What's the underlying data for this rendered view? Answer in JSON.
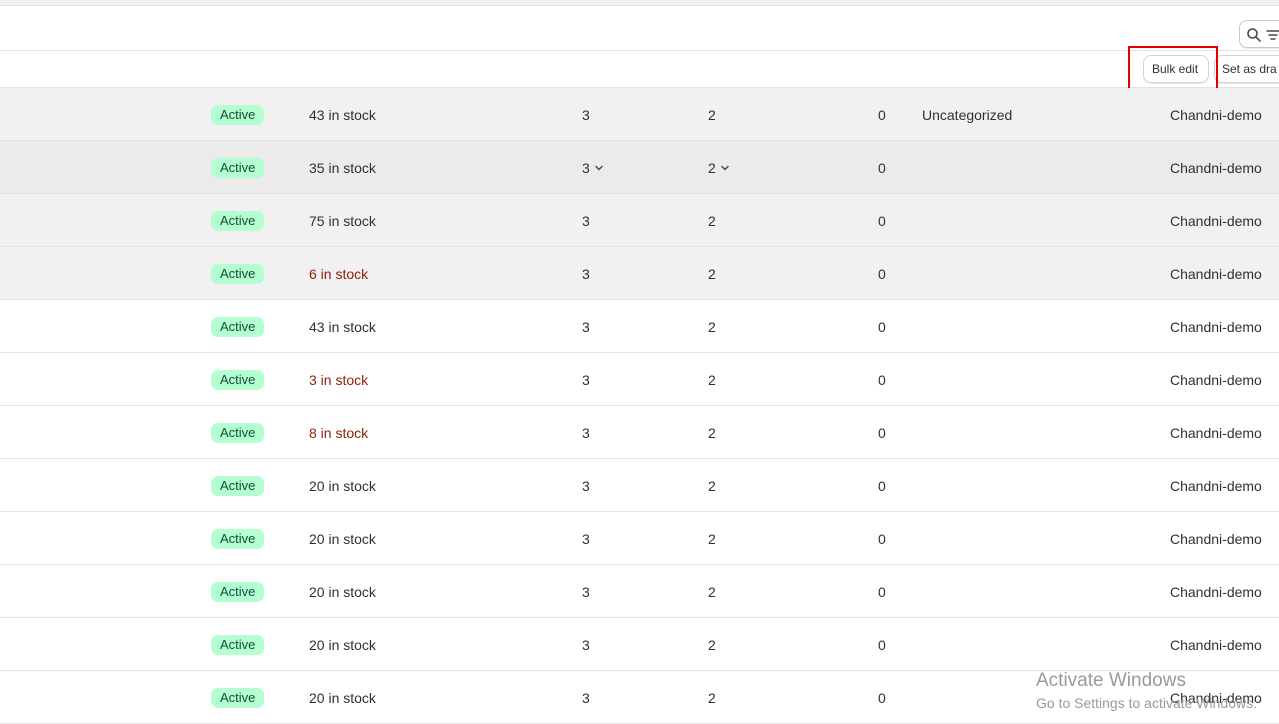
{
  "toolbar": {
    "search_filter_icons": [
      "search-icon",
      "filter-icon"
    ],
    "bulk_edit_label": "Bulk edit",
    "set_as_draft_label": "Set as dra"
  },
  "rows": [
    {
      "status": "Active",
      "inventory": "43 in stock",
      "low_stock": false,
      "markets": "3",
      "catalogs": "2",
      "sales_channels": "0",
      "category": "Uncategorized",
      "vendor": "Chandni-demo"
    },
    {
      "status": "Active",
      "inventory": "35 in stock",
      "low_stock": false,
      "markets": "3",
      "catalogs": "2",
      "sales_channels": "0",
      "category": "",
      "vendor": "Chandni-demo"
    },
    {
      "status": "Active",
      "inventory": "75 in stock",
      "low_stock": false,
      "markets": "3",
      "catalogs": "2",
      "sales_channels": "0",
      "category": "",
      "vendor": "Chandni-demo"
    },
    {
      "status": "Active",
      "inventory": "6 in stock",
      "low_stock": true,
      "markets": "3",
      "catalogs": "2",
      "sales_channels": "0",
      "category": "",
      "vendor": "Chandni-demo"
    },
    {
      "status": "Active",
      "inventory": "43 in stock",
      "low_stock": false,
      "markets": "3",
      "catalogs": "2",
      "sales_channels": "0",
      "category": "",
      "vendor": "Chandni-demo"
    },
    {
      "status": "Active",
      "inventory": "3 in stock",
      "low_stock": true,
      "markets": "3",
      "catalogs": "2",
      "sales_channels": "0",
      "category": "",
      "vendor": "Chandni-demo"
    },
    {
      "status": "Active",
      "inventory": "8 in stock",
      "low_stock": true,
      "markets": "3",
      "catalogs": "2",
      "sales_channels": "0",
      "category": "",
      "vendor": "Chandni-demo"
    },
    {
      "status": "Active",
      "inventory": "20 in stock",
      "low_stock": false,
      "markets": "3",
      "catalogs": "2",
      "sales_channels": "0",
      "category": "",
      "vendor": "Chandni-demo"
    },
    {
      "status": "Active",
      "inventory": "20 in stock",
      "low_stock": false,
      "markets": "3",
      "catalogs": "2",
      "sales_channels": "0",
      "category": "",
      "vendor": "Chandni-demo"
    },
    {
      "status": "Active",
      "inventory": "20 in stock",
      "low_stock": false,
      "markets": "3",
      "catalogs": "2",
      "sales_channels": "0",
      "category": "",
      "vendor": "Chandni-demo"
    },
    {
      "status": "Active",
      "inventory": "20 in stock",
      "low_stock": false,
      "markets": "3",
      "catalogs": "2",
      "sales_channels": "0",
      "category": "",
      "vendor": "Chandni-demo"
    },
    {
      "status": "Active",
      "inventory": "20 in stock",
      "low_stock": false,
      "markets": "3",
      "catalogs": "2",
      "sales_channels": "0",
      "category": "",
      "vendor": "Chandni-demo"
    }
  ],
  "watermark": {
    "title": "Activate Windows",
    "subtitle": "Go to Settings to activate Windows."
  },
  "colors": {
    "badge_bg": "#b4fed2",
    "badge_text": "#0c5132",
    "low_stock_text": "#8e1f0b",
    "highlight_box": "#e00000"
  }
}
